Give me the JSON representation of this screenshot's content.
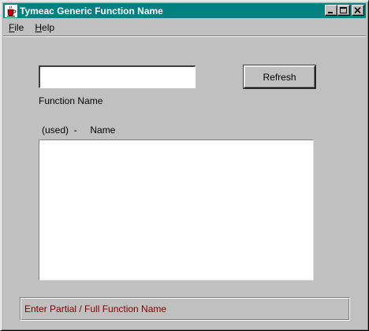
{
  "window": {
    "title": "Tymeac Generic Function Name",
    "icon": "java-coffee-cup-icon",
    "title_bar_color": "#008080"
  },
  "menu": {
    "items": [
      {
        "label_underlined": "F",
        "label_rest": "ile"
      },
      {
        "label_underlined": "H",
        "label_rest": "elp"
      }
    ]
  },
  "search": {
    "value": "",
    "label": "Function Name"
  },
  "refresh_button": {
    "label": "Refresh"
  },
  "list": {
    "header": "(used)  -     Name",
    "items": []
  },
  "status": {
    "text": "Enter Partial / Full Function Name",
    "color": "#800000"
  }
}
